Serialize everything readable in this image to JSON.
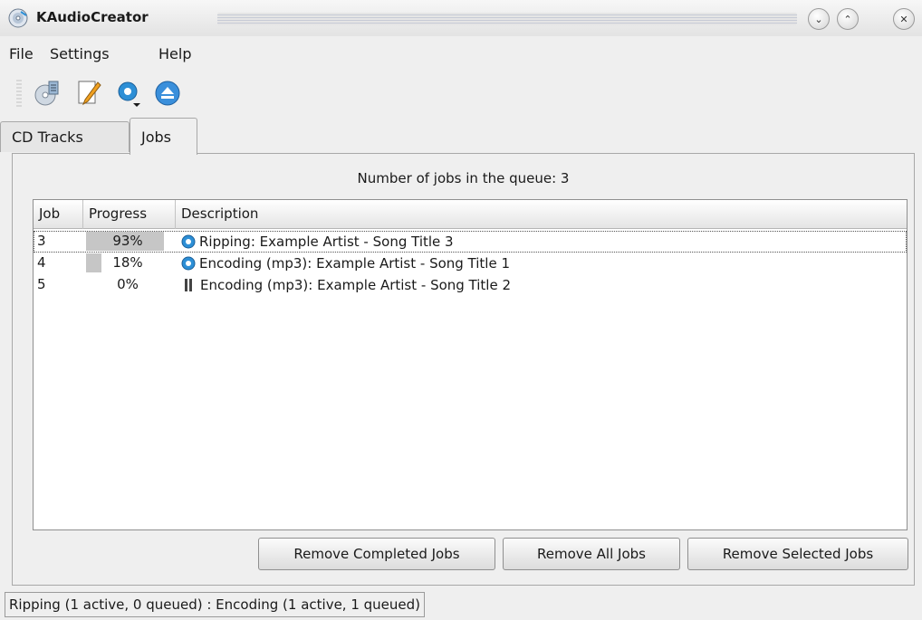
{
  "window": {
    "title": "KAudioCreator",
    "buttons": [
      "minimize-icon",
      "maximize-icon",
      "close-icon"
    ]
  },
  "menu": {
    "file": "File",
    "settings": "Settings",
    "help": "Help"
  },
  "toolbar": {
    "icons": [
      "rip-cd-icon",
      "edit-album-icon",
      "configure-icon",
      "eject-icon"
    ]
  },
  "tabs": {
    "cd_tracks": "CD Tracks",
    "jobs": "Jobs",
    "active": "Jobs"
  },
  "jobs": {
    "queue_count": "Number of jobs in the queue: 3",
    "columns": {
      "job": "Job",
      "progress": "Progress",
      "description": "Description"
    },
    "rows": [
      {
        "job": "3",
        "progress": "93%",
        "progress_value": 93,
        "status_icon": "working-gear-icon",
        "description": "Ripping: Example Artist - Song Title 3",
        "selected": true
      },
      {
        "job": "4",
        "progress": "18%",
        "progress_value": 18,
        "status_icon": "working-gear-icon",
        "description": "Encoding (mp3): Example Artist - Song Title 1",
        "selected": false
      },
      {
        "job": "5",
        "progress": "0%",
        "progress_value": 0,
        "status_icon": "pause-icon",
        "description": "Encoding (mp3): Example Artist - Song Title 2",
        "selected": false
      }
    ],
    "buttons": {
      "remove_completed": "Remove Completed Jobs",
      "remove_all": "Remove All Jobs",
      "remove_selected": "Remove Selected Jobs"
    }
  },
  "status": {
    "text": "Ripping (1 active, 0 queued) : Encoding (1 active, 1 queued)"
  },
  "colors": {
    "accent": "#2d8fd6",
    "progress_fill": "#c6c6c6"
  }
}
